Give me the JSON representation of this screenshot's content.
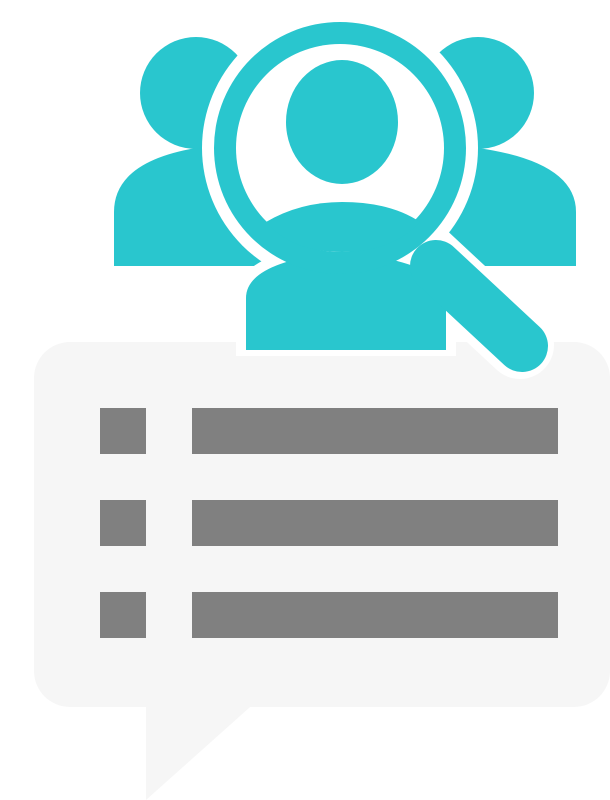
{
  "illustration": {
    "name": "people-search-list-illustration",
    "icon_names": [
      "people-search-icon",
      "user-silhouette-icon",
      "magnifier-icon",
      "speech-bubble-icon",
      "list-icon"
    ],
    "list_rows": 3,
    "colors": {
      "accent": "#29c6ce",
      "bubble": "#f6f6f6",
      "list": "#808080",
      "background": "#ffffff",
      "outline": "#ffffff"
    }
  }
}
